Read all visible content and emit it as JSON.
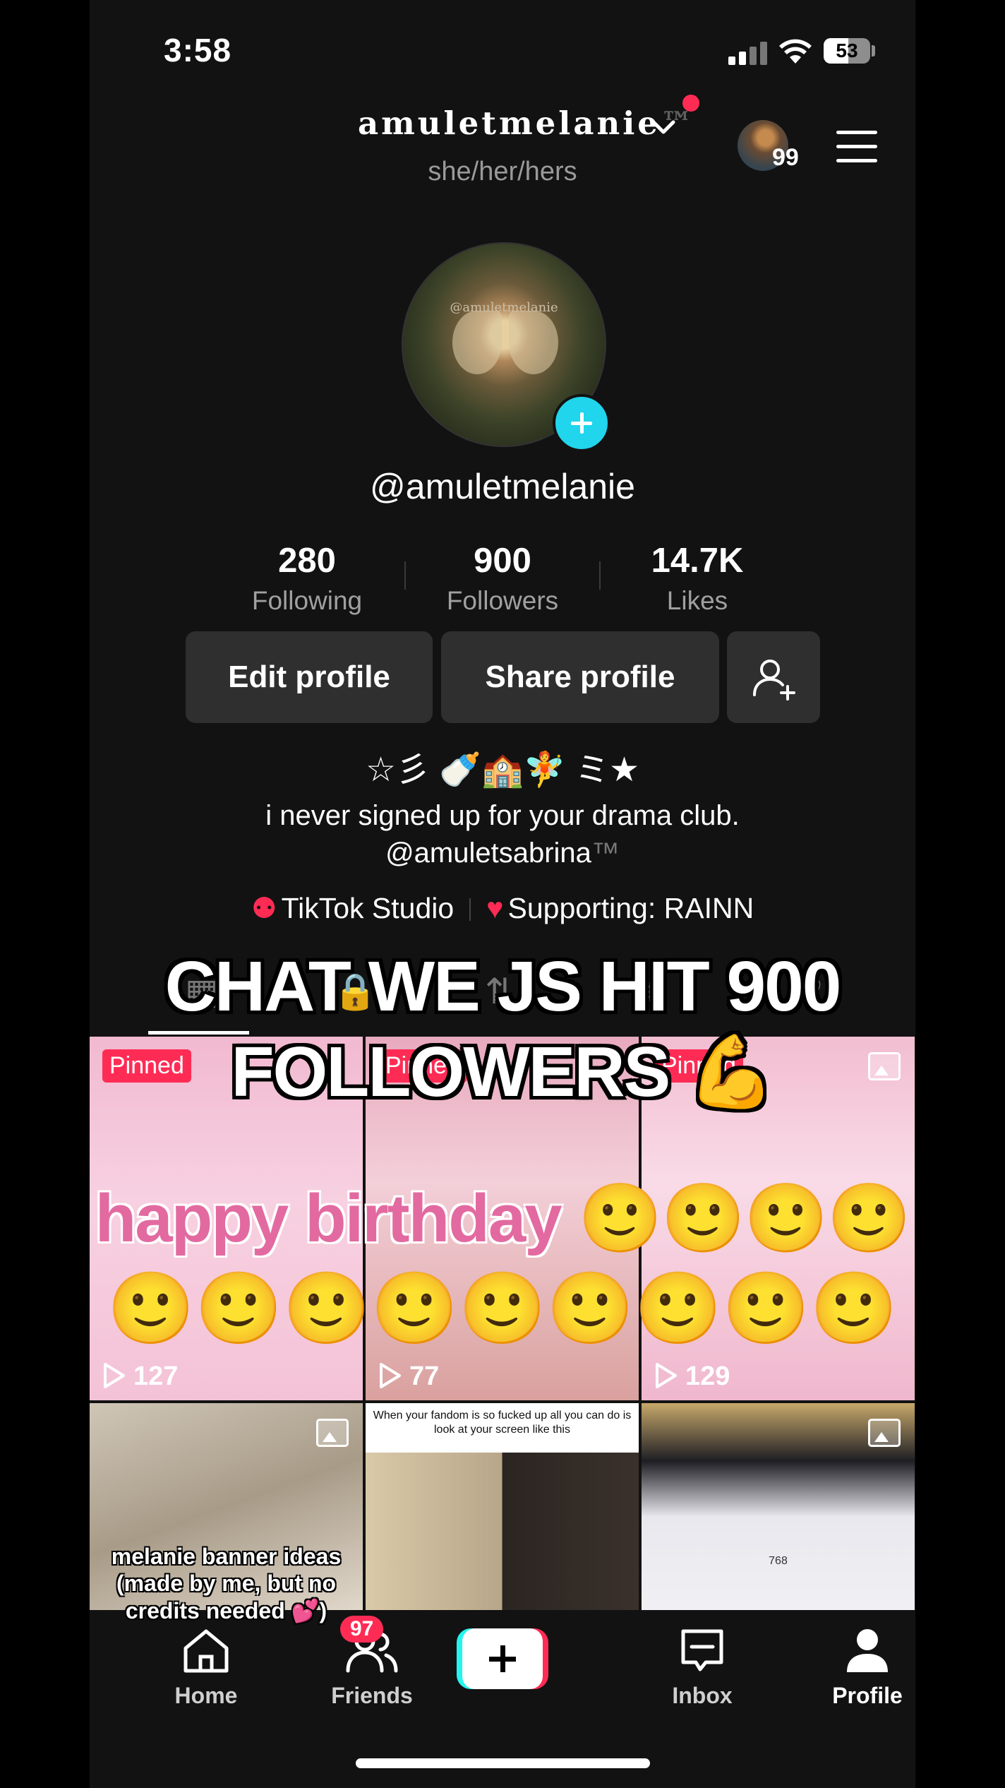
{
  "status_bar": {
    "time": "3:58",
    "battery": "53",
    "battery_level": 0.53
  },
  "header": {
    "username": "amuletmelanie",
    "tm": "™",
    "pronouns": "she/her/hers",
    "story_count": "99"
  },
  "profile": {
    "avatar_watermark": "@amuletmelanie",
    "handle": "@amuletmelanie",
    "stats": [
      {
        "value": "280",
        "label": "Following"
      },
      {
        "value": "900",
        "label": "Followers"
      },
      {
        "value": "14.7K",
        "label": "Likes"
      }
    ],
    "buttons": {
      "edit": "Edit profile",
      "share": "Share profile"
    },
    "bio_emoji": "☆彡 🍼🏫🧚 ミ★",
    "bio_line1": "i never signed up for your drama club.",
    "bio_line2": "@amuletsabrina",
    "bio_line2_tm": "™",
    "links": {
      "studio": "TikTok Studio",
      "supporting": "Supporting: RAINN"
    }
  },
  "overlay_caption": {
    "line1": "CHAT WE JS HIT 900",
    "line2": "FOLLOWERS 💪"
  },
  "grid": {
    "pinned_label": "Pinned",
    "videos": [
      {
        "views": "127"
      },
      {
        "views": "77"
      },
      {
        "views": "129"
      }
    ],
    "birthday_text": "happy birthday",
    "birthday_emojis_1": "🙂🙂🙂🙂",
    "birthday_emojis_2": "🙂🙂🙂🙂🙂🙂🙂🙂🙂",
    "post4_caption": "melanie banner ideas (made by me, but no credits needed 💕)",
    "post5_caption": "When your fandom is so fucked up all you can do is look at your screen like this",
    "post6_number": "768"
  },
  "bottom_nav": {
    "home": "Home",
    "friends": "Friends",
    "friends_badge": "97",
    "inbox": "Inbox",
    "profile": "Profile"
  },
  "colors": {
    "accent": "#fe2c55",
    "cyan": "#20d5ec",
    "background": "#121212"
  }
}
